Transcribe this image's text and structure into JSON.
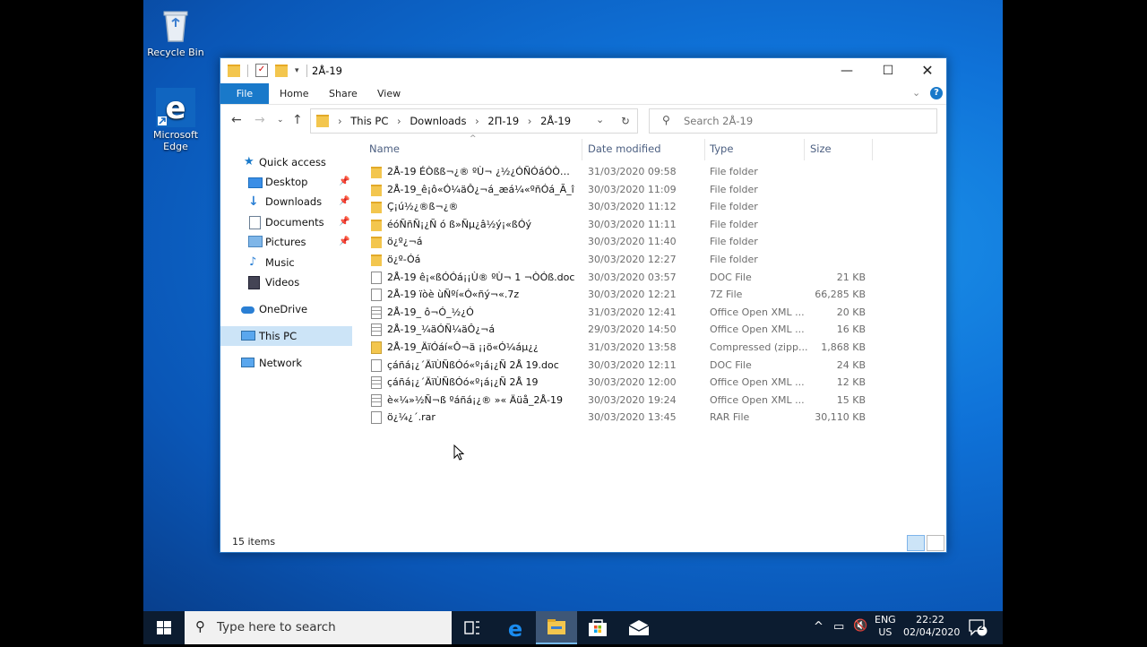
{
  "desktop": {
    "icons": [
      {
        "label": "Recycle Bin"
      },
      {
        "label": "Microsoft Edge"
      }
    ]
  },
  "window": {
    "title": "2Å-19",
    "ribbon_tabs": [
      "File",
      "Home",
      "Share",
      "View"
    ],
    "breadcrumb": [
      "This PC",
      "Downloads",
      "2П-19",
      "2Å-19"
    ],
    "search_placeholder": "Search 2Å-19",
    "nav": {
      "quick_access": "Quick access",
      "items": [
        "Desktop",
        "Downloads",
        "Documents",
        "Pictures",
        "Music",
        "Videos"
      ],
      "onedrive": "OneDrive",
      "this_pc": "This PC",
      "network": "Network"
    },
    "columns": {
      "name": "Name",
      "date": "Date modified",
      "type": "Type",
      "size": "Size"
    },
    "files": [
      {
        "icon": "folder",
        "name": "2Å-19 ÉÒßß¬¿® ºÙ¬ ¿½¿ÓÑÓáÓÒÓá ...",
        "date": "31/03/2020 09:58",
        "type": "File folder",
        "size": ""
      },
      {
        "icon": "folder",
        "name": "2Å-19_ê¡ô«Ó¼äÔ¿¬á_æá¼«ºñÓá_Ã_î",
        "date": "30/03/2020 11:09",
        "type": "File folder",
        "size": ""
      },
      {
        "icon": "folder",
        "name": "Ç¡ú½¿®ß¬¿®",
        "date": "30/03/2020 11:12",
        "type": "File folder",
        "size": ""
      },
      {
        "icon": "folder",
        "name": "éóÑñÑ¡¿Ñ ó ß»Ñµ¿â½ý¡«ßÓý",
        "date": "30/03/2020 11:11",
        "type": "File folder",
        "size": ""
      },
      {
        "icon": "folder",
        "name": "ö¿º¿¬á",
        "date": "30/03/2020 11:40",
        "type": "File folder",
        "size": ""
      },
      {
        "icon": "folder",
        "name": "ö¿º-Óá",
        "date": "30/03/2020 12:27",
        "type": "File folder",
        "size": ""
      },
      {
        "icon": "file",
        "name": "2Å-19 ê¡«ßÓÓá¡¡Ù® ºÙ¬ 1 ¬ÒÓß.doc",
        "date": "30/03/2020 03:57",
        "type": "DOC File",
        "size": "21 KB"
      },
      {
        "icon": "file",
        "name": "2Å-19 ïòè ùÑºí«Ó«ñý¬«.7z",
        "date": "30/03/2020 12:21",
        "type": "7Z File",
        "size": "66,285 KB"
      },
      {
        "icon": "office",
        "name": "2Å-19_ ô¬Ó_½¿Ó",
        "date": "31/03/2020 12:41",
        "type": "Office Open XML ...",
        "size": "20 KB"
      },
      {
        "icon": "office",
        "name": "2Å-19_¼äÓÑ¼äÔ¿¬á",
        "date": "29/03/2020 14:50",
        "type": "Office Open XML ...",
        "size": "16 KB"
      },
      {
        "icon": "zip",
        "name": "2Å-19_ÄïÓáí«Ô¬ä ¡¡ö«Ó¼áµ¿¿",
        "date": "31/03/2020 13:58",
        "type": "Compressed (zipp...",
        "size": "1,868 KB"
      },
      {
        "icon": "file",
        "name": "çáñá¡¿´ÄïÙÑßÓó«º¡á¡¿Ñ 2Å 19.doc",
        "date": "30/03/2020 12:11",
        "type": "DOC File",
        "size": "24 KB"
      },
      {
        "icon": "office",
        "name": "çáñá¡¿´ÄïÙÑßÓó«º¡á¡¿Ñ 2Å 19",
        "date": "30/03/2020 12:00",
        "type": "Office Open XML ...",
        "size": "12 KB"
      },
      {
        "icon": "office",
        "name": "è«¼»½Ñ¬ß ºáñá¡¿® »« Äüå_2Å-19",
        "date": "30/03/2020 19:24",
        "type": "Office Open XML ...",
        "size": "15 KB"
      },
      {
        "icon": "file",
        "name": "ö¿¼¿´.rar",
        "date": "30/03/2020 13:45",
        "type": "RAR File",
        "size": "30,110 KB"
      }
    ],
    "status": "15 items"
  },
  "taskbar": {
    "search_placeholder": "Type here to search",
    "lang_top": "ENG",
    "lang_bottom": "US",
    "time": "22:22",
    "date": "02/04/2020",
    "notification_count": "2"
  },
  "colors": {
    "accent": "#1979ca",
    "desktop": "#0f72d8",
    "taskbar": "#0c1c30",
    "folder": "#f3c64e"
  }
}
